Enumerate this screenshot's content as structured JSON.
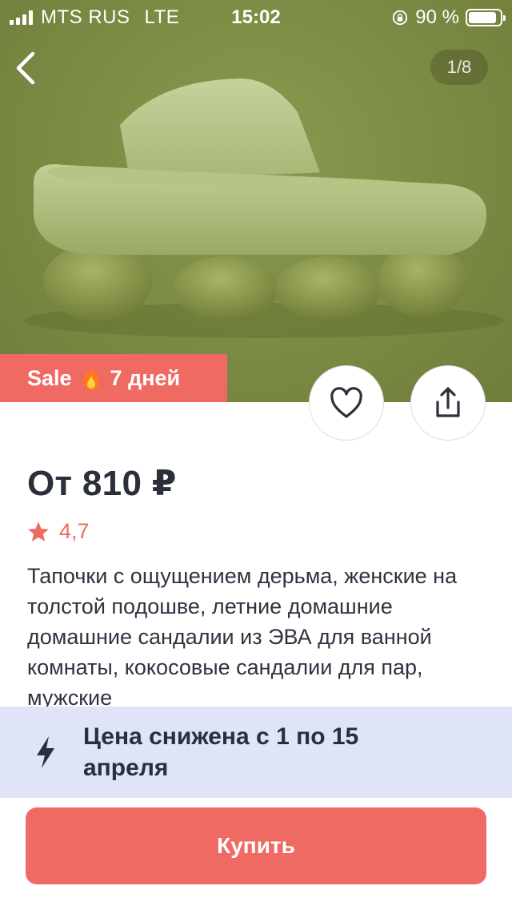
{
  "status_bar": {
    "carrier": "MTS RUS",
    "network": "LTE",
    "time": "15:02",
    "battery_text": "90 %",
    "battery_level": 0.9
  },
  "gallery": {
    "counter": "1/8",
    "product_image": "olive-green-slide-sandal"
  },
  "sale_badge": {
    "label": "Sale",
    "icon": "fire-icon",
    "duration": "7 дней"
  },
  "actions": {
    "favorite_icon": "heart-icon",
    "share_icon": "share-icon",
    "back_icon": "chevron-left-icon"
  },
  "product": {
    "price": "От 810 ₽",
    "rating": "4,7",
    "title": "Тапочки с ощущением дерьма, женские на толстой подошве, летние домашние домашние сандалии из ЭВА для ванной комнаты, кокосовые сандалии для пар, мужские"
  },
  "promo": {
    "icon": "lightning-icon",
    "text": "Цена снижена с 1 по 15 апреля"
  },
  "buy_button": {
    "label": "Купить"
  },
  "colors": {
    "accent": "#ee6a63",
    "promo_bg": "#dfe4f6",
    "text": "#2b2f3a",
    "hero_bg": "#7e8d45"
  }
}
